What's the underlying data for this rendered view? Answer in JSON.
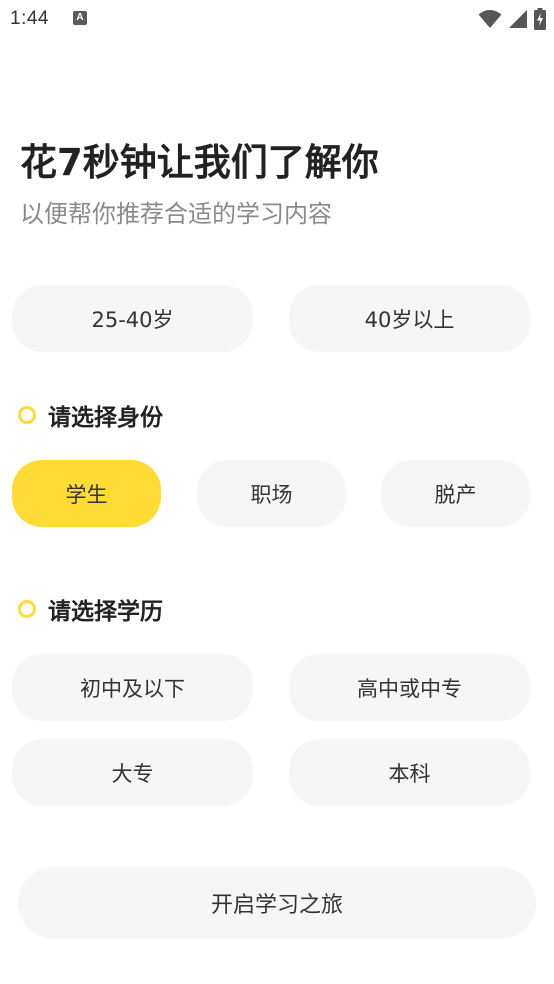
{
  "status_bar": {
    "time": "1:44",
    "notification_icon": "a-icon",
    "icons": [
      "wifi-icon",
      "cell-signal-icon",
      "battery-charging-icon"
    ]
  },
  "header": {
    "title": "花7秒钟让我们了解你",
    "subtitle": "以便帮你推荐合适的学习内容"
  },
  "age": {
    "options": [
      {
        "label": "25-40岁",
        "selected": false
      },
      {
        "label": "40岁以上",
        "selected": false
      }
    ]
  },
  "identity": {
    "heading": "请选择身份",
    "options": [
      {
        "label": "学生",
        "selected": true
      },
      {
        "label": "职场",
        "selected": false
      },
      {
        "label": "脱产",
        "selected": false
      }
    ]
  },
  "education": {
    "heading": "请选择学历",
    "options": [
      {
        "label": "初中及以下",
        "selected": false
      },
      {
        "label": "高中或中专",
        "selected": false
      },
      {
        "label": "大专",
        "selected": false
      },
      {
        "label": "本科",
        "selected": false
      }
    ]
  },
  "footer": {
    "start_label": "开启学习之旅"
  },
  "colors": {
    "accent": "#fedb35",
    "pill_bg": "#f6f6f6",
    "text_primary": "#222222",
    "text_secondary": "#8a8a8a"
  }
}
